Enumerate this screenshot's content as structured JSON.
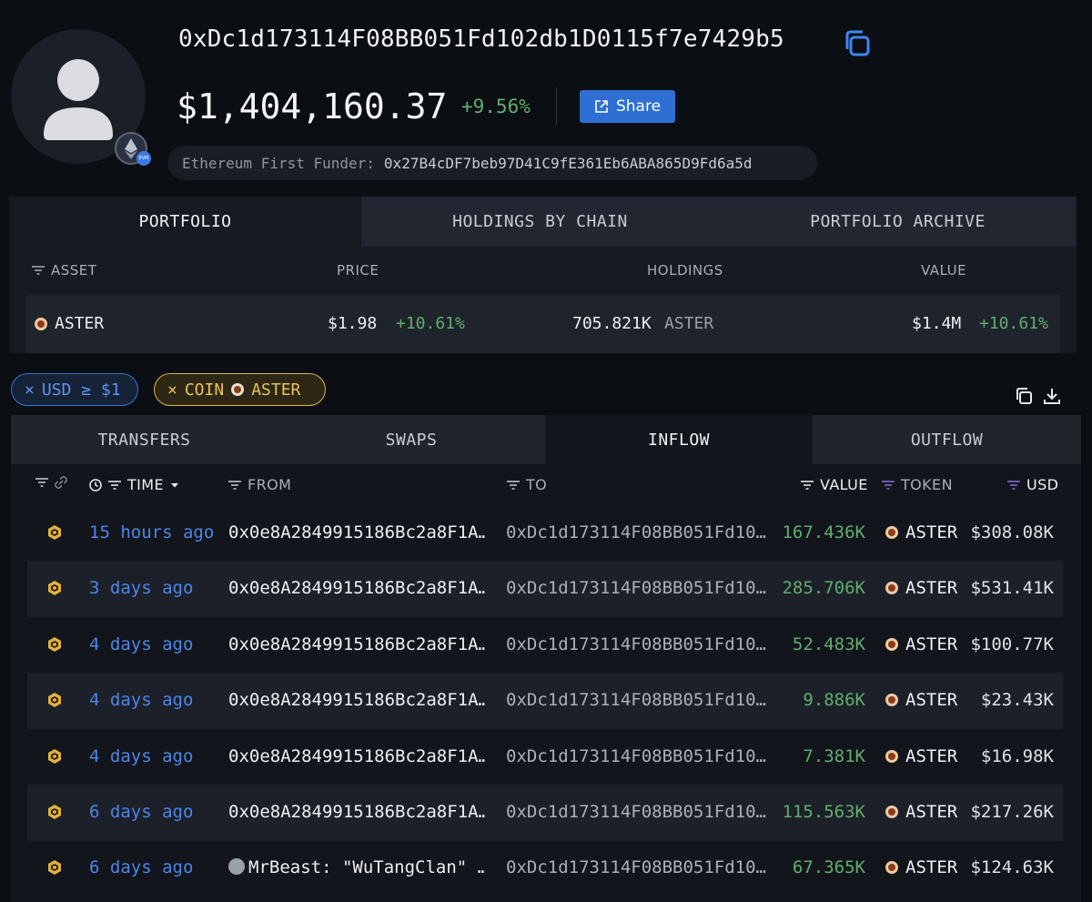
{
  "profile": {
    "address": "0xDc1d173114F08BB051Fd102db1D0115f7e7429b5",
    "balance": "$1,404,160.37",
    "balance_change": "+9.56%",
    "share_label": "Share",
    "funder_label": "Ethereum First Funder:",
    "funder_address": "0x27B4cDF7beb97D41C9fE361Eb6ABA865D9Fd6a5d",
    "evm_tag": "EVM"
  },
  "portfolio": {
    "tabs": [
      {
        "label": "PORTFOLIO",
        "active": true
      },
      {
        "label": "HOLDINGS BY CHAIN",
        "active": false
      },
      {
        "label": "PORTFOLIO ARCHIVE",
        "active": false
      }
    ],
    "headers": {
      "asset": "ASSET",
      "price": "PRICE",
      "holdings": "HOLDINGS",
      "value": "VALUE"
    },
    "row": {
      "asset": "ASTER",
      "price": "$1.98",
      "price_change": "+10.61%",
      "holdings": "705.821K",
      "holdings_unit": "ASTER",
      "value": "$1.4M",
      "value_change": "+10.61%"
    }
  },
  "filters": {
    "usd": {
      "x": "×",
      "label": "USD ≥ $1"
    },
    "coin": {
      "x": "×",
      "label": "COIN",
      "coin": "ASTER"
    }
  },
  "transfers": {
    "tabs": [
      {
        "label": "TRANSFERS",
        "active": false
      },
      {
        "label": "SWAPS",
        "active": false
      },
      {
        "label": "INFLOW",
        "active": true
      },
      {
        "label": "OUTFLOW",
        "active": false
      }
    ],
    "headers": {
      "time": "TIME",
      "from": "FROM",
      "to": "TO",
      "value": "VALUE",
      "token": "TOKEN",
      "usd": "USD"
    },
    "rows": [
      {
        "time": "15 hours ago",
        "from": "0x0e8A2849915186Bc2a8F1A…",
        "to": "0xDc1d173114F08BB051Fd10…",
        "value": "167.436K",
        "token": "ASTER",
        "usd": "$308.08K"
      },
      {
        "time": "3 days ago",
        "from": "0x0e8A2849915186Bc2a8F1A…",
        "to": "0xDc1d173114F08BB051Fd10…",
        "value": "285.706K",
        "token": "ASTER",
        "usd": "$531.41K"
      },
      {
        "time": "4 days ago",
        "from": "0x0e8A2849915186Bc2a8F1A…",
        "to": "0xDc1d173114F08BB051Fd10…",
        "value": "52.483K",
        "token": "ASTER",
        "usd": "$100.77K"
      },
      {
        "time": "4 days ago",
        "from": "0x0e8A2849915186Bc2a8F1A…",
        "to": "0xDc1d173114F08BB051Fd10…",
        "value": "9.886K",
        "token": "ASTER",
        "usd": "$23.43K"
      },
      {
        "time": "4 days ago",
        "from": "0x0e8A2849915186Bc2a8F1A…",
        "to": "0xDc1d173114F08BB051Fd10…",
        "value": "7.381K",
        "token": "ASTER",
        "usd": "$16.98K"
      },
      {
        "time": "6 days ago",
        "from": "0x0e8A2849915186Bc2a8F1A…",
        "to": "0xDc1d173114F08BB051Fd10…",
        "value": "115.563K",
        "token": "ASTER",
        "usd": "$217.26K"
      },
      {
        "time": "6 days ago",
        "from": "MrBeast: \"WuTangClan\" …",
        "to": "0xDc1d173114F08BB051Fd10…",
        "value": "67.365K",
        "token": "ASTER",
        "usd": "$124.63K"
      }
    ]
  },
  "colors": {
    "accent_blue": "#2f6fd3",
    "positive_green": "#5fae6e",
    "link_blue": "#4c86ea",
    "coin_chip_gold": "#e7c25a"
  }
}
